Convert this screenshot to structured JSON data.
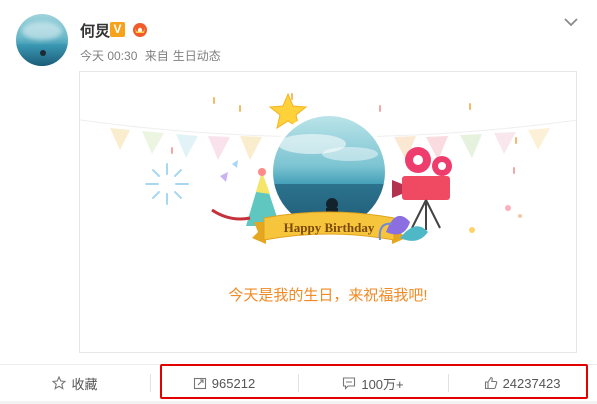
{
  "post": {
    "username": "何炅",
    "verified_badge": "V",
    "time": "今天 00:30",
    "source_prefix": "来自",
    "source": "生日动态"
  },
  "media": {
    "banner_text": "Happy Birthday",
    "message": "今天是我的生日，来祝福我吧!"
  },
  "actions": {
    "favorite_label": "收藏",
    "share_count": "965212",
    "comment_count": "100万+",
    "like_count": "24237423"
  },
  "colors": {
    "accent_orange": "#f08a25",
    "badge_orange": "#f7a21b",
    "highlight_red": "#e30000",
    "ribbon_yellow": "#f7c53b"
  },
  "icons": {
    "collapse": "chevron-down-icon",
    "favorite": "star-outline-icon",
    "share": "share-arrow-icon",
    "comment": "comment-bubble-icon",
    "like": "thumbs-up-icon"
  }
}
